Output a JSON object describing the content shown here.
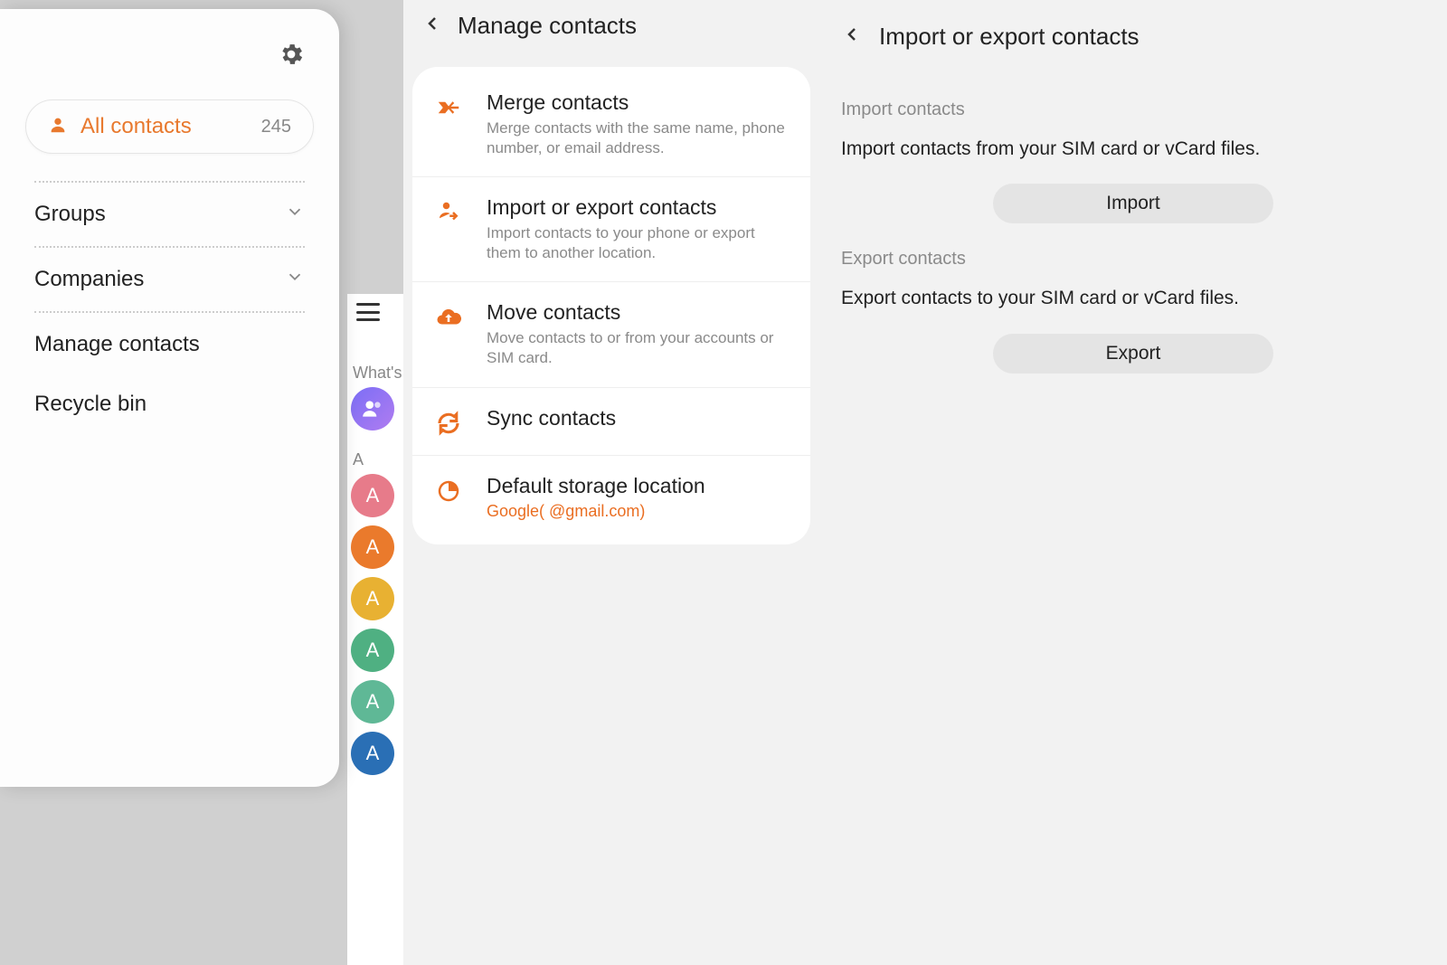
{
  "panel1": {
    "all_contacts_label": "All contacts",
    "all_contacts_count": "245",
    "groups_label": "Groups",
    "companies_label": "Companies",
    "manage_label": "Manage contacts",
    "recycle_label": "Recycle bin",
    "section_whats": "What's",
    "section_a": "A",
    "avatar_letters": [
      "A",
      "A",
      "A",
      "A",
      "A",
      "A"
    ],
    "avatar_colors": [
      "#e77b8a",
      "#ea7a2c",
      "#e8b132",
      "#4fb082",
      "#5fb896",
      "#2a6fb5"
    ]
  },
  "panel2": {
    "header_title": "Manage contacts",
    "items": [
      {
        "title": "Merge contacts",
        "desc": "Merge contacts with the same name, phone number, or email address."
      },
      {
        "title": "Import or export contacts",
        "desc": "Import contacts to your phone or export them to another location."
      },
      {
        "title": "Move contacts",
        "desc": "Move contacts to or from your accounts or SIM card."
      },
      {
        "title": "Sync contacts",
        "desc": ""
      },
      {
        "title": "Default storage location",
        "sub": "Google(          @gmail.com)"
      }
    ]
  },
  "panel3": {
    "header_title": "Import or export contacts",
    "import_section": "Import contacts",
    "import_desc": "Import contacts from your SIM card or vCard files.",
    "import_btn": "Import",
    "export_section": "Export contacts",
    "export_desc": "Export contacts to your SIM card or vCard files.",
    "export_btn": "Export"
  }
}
